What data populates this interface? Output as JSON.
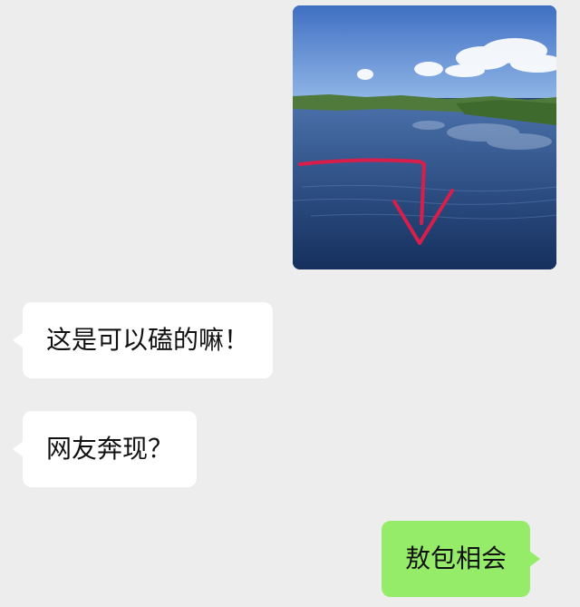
{
  "chat": {
    "image": {
      "description_icon": "lake-photo-with-red-arrow"
    },
    "messages": [
      {
        "sender": "other",
        "text": "这是可以磕的嘛！"
      },
      {
        "sender": "other",
        "text": "网友奔现？"
      },
      {
        "sender": "self",
        "text": "敖包相会"
      }
    ]
  },
  "colors": {
    "background": "#ededed",
    "incoming_bubble": "#ffffff",
    "outgoing_bubble": "#95ec69",
    "arrow": "#d81e4a"
  }
}
